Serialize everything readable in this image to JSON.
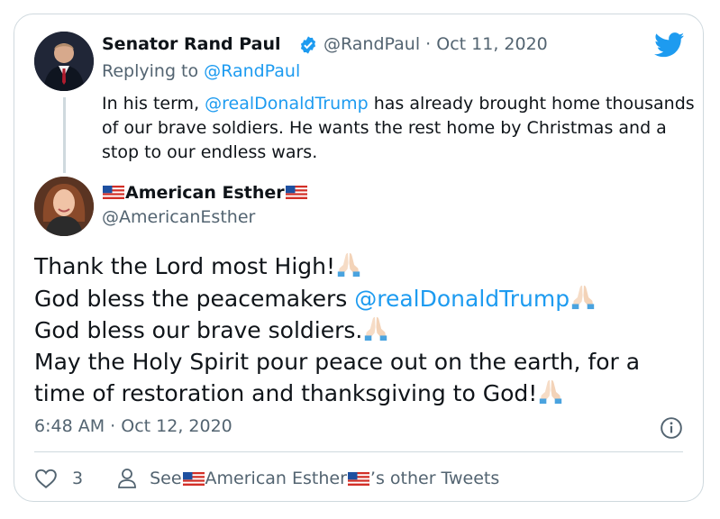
{
  "reply_tweet": {
    "name": "Senator Rand Paul",
    "handle": "@RandPaul",
    "separator": "·",
    "date": "Oct 11, 2020",
    "replying_prefix": "Replying to ",
    "replying_handle": "@RandPaul",
    "text_1": "In his term, ",
    "mention": "@realDonaldTrump",
    "text_2": " has already brought home thousands of our brave soldiers. He wants the rest home by Christmas and a stop to our endless wars."
  },
  "main_tweet": {
    "name": "American Esther",
    "handle": "@AmericanEsther",
    "lines": {
      "l1": "Thank the Lord most High!",
      "l2": "God bless the peacemakers ",
      "l2_mention": "@realDonaldTrump",
      "l3": "God bless our brave soldiers.",
      "l4": "May the Holy Spirit pour peace out on the earth, for a time of restoration and thanksgiving to God!"
    },
    "time": "6:48 AM",
    "separator": "·",
    "date": "Oct 12, 2020"
  },
  "actions": {
    "like_count": "3",
    "see_prefix": "See ",
    "see_name": "American Esther",
    "see_suffix": "’s other Tweets"
  },
  "icons": {
    "brand": "twitter-bird-icon",
    "verified": "verified-badge-icon",
    "info": "info-icon",
    "like": "heart-icon",
    "profile": "person-icon",
    "praying": "praying-hands-emoji",
    "flag": "us-flag-emoji"
  },
  "colors": {
    "link": "#1d9bf0",
    "secondary_text": "#536471",
    "border": "#cfd9de"
  }
}
